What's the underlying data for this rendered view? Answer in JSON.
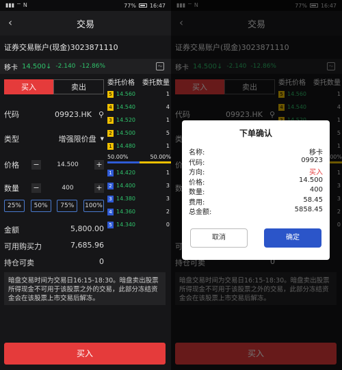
{
  "status": {
    "time": "16:47",
    "battery": "77%"
  },
  "title": "交易",
  "account": "证券交易账户(现金)3023871110",
  "quote": {
    "name": "移卡",
    "price": "14.500",
    "change": "-2.140",
    "change_pct": "-12.86%"
  },
  "tabs": {
    "buy": "买入",
    "sell": "卖出"
  },
  "form": {
    "code_label": "代码",
    "code_value": "09923.HK",
    "type_label": "类型",
    "type_value": "增强限价盘",
    "price_label": "价格",
    "price_value": "14.500",
    "qty_label": "数量",
    "qty_value": "400",
    "percents": [
      "25%",
      "50%",
      "75%",
      "100%"
    ],
    "amount_label": "金额",
    "amount_value": "5,800.00",
    "power_label": "可用购买力",
    "power_value": "7,685.96",
    "hold_label": "持仓可卖",
    "hold_value": "0"
  },
  "orderbook": {
    "price_header": "委托价格",
    "qty_header": "委托数量",
    "asks": [
      {
        "n": "5",
        "price": "14.560",
        "qty": "1"
      },
      {
        "n": "4",
        "price": "14.540",
        "qty": "4"
      },
      {
        "n": "3",
        "price": "14.520",
        "qty": "1"
      },
      {
        "n": "2",
        "price": "14.500",
        "qty": "5"
      },
      {
        "n": "1",
        "price": "14.480",
        "qty": "1"
      }
    ],
    "ratio_left": "50.00%",
    "ratio_right": "50.00%",
    "bids": [
      {
        "n": "1",
        "price": "14.420",
        "qty": "1"
      },
      {
        "n": "2",
        "price": "14.400",
        "qty": "3"
      },
      {
        "n": "3",
        "price": "14.380",
        "qty": "3"
      },
      {
        "n": "4",
        "price": "14.360",
        "qty": "2"
      },
      {
        "n": "5",
        "price": "14.340",
        "qty": "0"
      }
    ]
  },
  "note": "暗盘交易时间为交易日16:15-18:30。暗盘卖出股票所得现金不可用于该股票之外的交易，此部分冻结资金会在该股票上市交易后解冻。",
  "submit": "买入",
  "dialog": {
    "title": "下单确认",
    "rows": [
      {
        "k": "名称:",
        "v": "移卡"
      },
      {
        "k": "代码:",
        "v": "09923"
      },
      {
        "k": "方向:",
        "v": "买入"
      },
      {
        "k": "价格:",
        "v": "14.500"
      },
      {
        "k": "数量:",
        "v": "400"
      },
      {
        "k": "费用:",
        "v": "58.45"
      },
      {
        "k": "总金额:",
        "v": "5858.45"
      }
    ],
    "cancel": "取消",
    "confirm": "确定"
  },
  "colors": {
    "buy_red": "#e53b3b",
    "down_green": "#2fc26b",
    "confirm_blue": "#2b55c9",
    "ask_yellow": "#f0c000"
  }
}
